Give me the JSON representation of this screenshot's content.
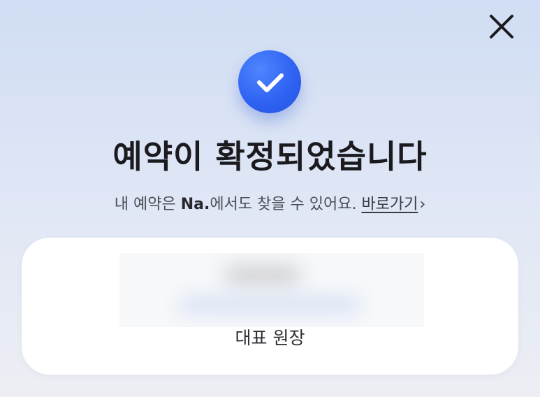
{
  "header": {
    "close_icon": "close-icon"
  },
  "badge": {
    "icon": "check-icon",
    "color": "#2f63f2"
  },
  "confirmation": {
    "title": "예약이 확정되었습니다",
    "subtitle_prefix": "내 예약은 ",
    "subtitle_brand": "Na.",
    "subtitle_suffix": "에서도 찾을 수 있어요. ",
    "shortcut_label": "바로가기",
    "shortcut_chevron": "›"
  },
  "card": {
    "role": "대표 원장"
  }
}
